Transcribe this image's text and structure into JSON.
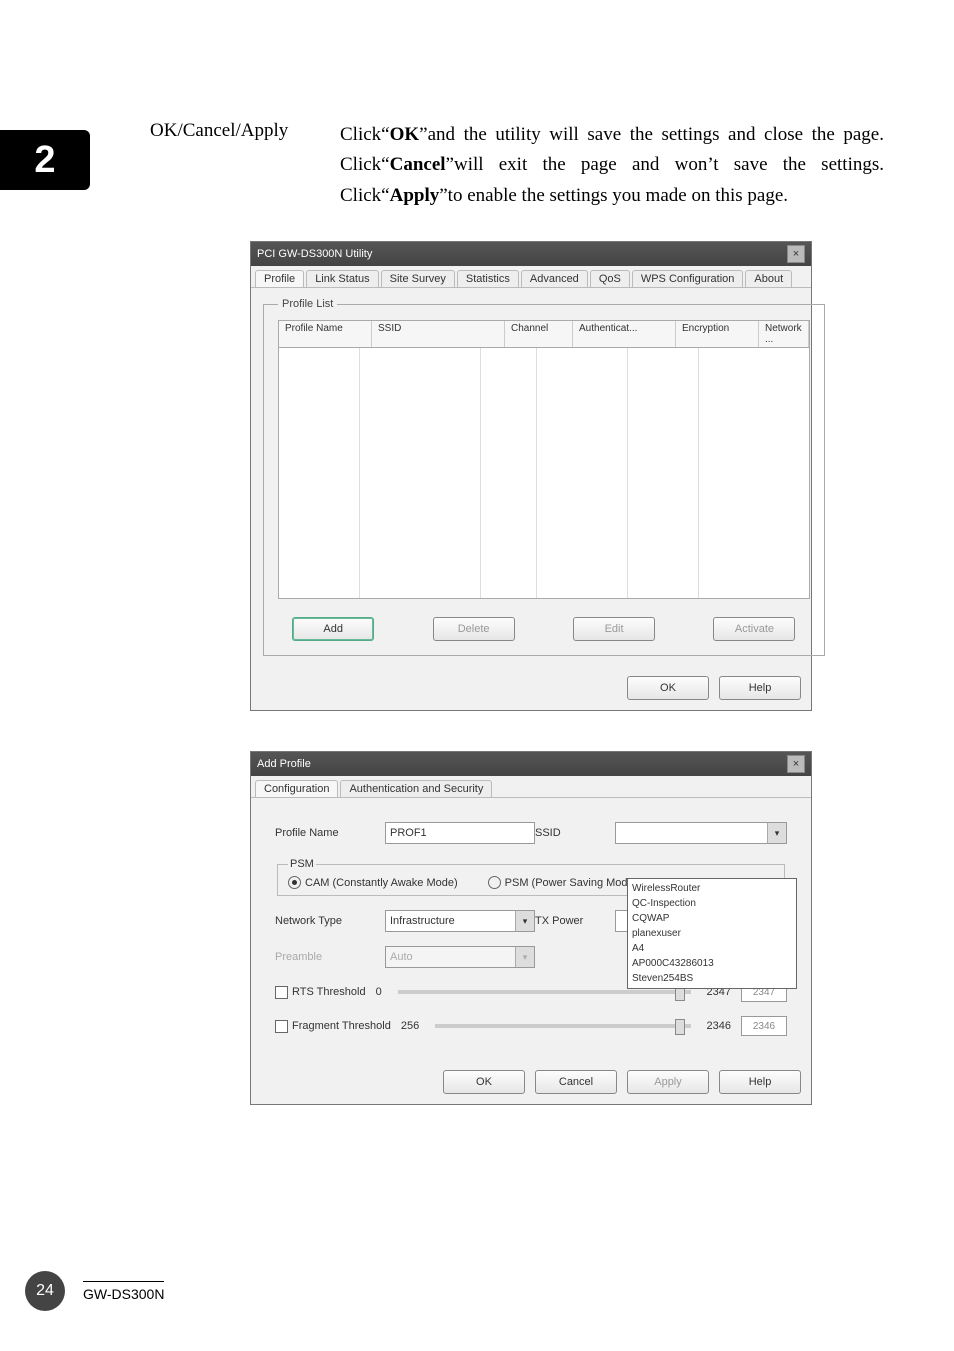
{
  "chapter_number": "2",
  "row": {
    "label": "OK/Cancel/Apply",
    "desc_parts": {
      "p1": "Click“",
      "b1": "OK",
      "p2": "”and the utility will save the settings and close the page. Click“",
      "b2": "Cancel",
      "p3": "”will exit the page and won’t save the settings. Click“",
      "b3": "Apply",
      "p4": "”to enable the settings you made on this page."
    }
  },
  "shot1": {
    "title": "PCI GW-DS300N Utility",
    "tabs": [
      "Profile",
      "Link Status",
      "Site Survey",
      "Statistics",
      "Advanced",
      "QoS",
      "WPS Configuration",
      "About"
    ],
    "active_tab_index": 0,
    "group_label": "Profile List",
    "columns": [
      "Profile Name",
      "SSID",
      "Channel",
      "Authenticat...",
      "Encryption",
      "Network ..."
    ],
    "buttons": {
      "add": "Add",
      "delete": "Delete",
      "edit": "Edit",
      "activate": "Activate"
    },
    "bottom": {
      "ok": "OK",
      "help": "Help"
    }
  },
  "shot2": {
    "title": "Add Profile",
    "tabs": [
      "Configuration",
      "Authentication and Security"
    ],
    "active_tab_index": 0,
    "labels": {
      "profile_name": "Profile Name",
      "ssid": "SSID",
      "psm": "PSM",
      "cam": "CAM (Constantly Awake Mode)",
      "psm_radio": "PSM (Power Saving Mode)",
      "network_type": "Network Type",
      "tx_power": "TX Power",
      "preamble": "Preamble",
      "rts": "RTS Threshold",
      "frag": "Fragment Threshold"
    },
    "values": {
      "profile_name": "PROF1",
      "ssid": "",
      "network_type": "Infrastructure",
      "tx_power": "",
      "preamble": "Auto",
      "rts_min": "0",
      "rts_val": "2347",
      "rts_box": "2347",
      "frag_min": "256",
      "frag_val": "2346",
      "frag_box": "2346"
    },
    "ssid_list": [
      "WirelessRouter",
      "QC-Inspection",
      "CQWAP",
      "planexuser",
      "A4",
      "AP000C43286013",
      "Steven254BS"
    ],
    "bottom": {
      "ok": "OK",
      "cancel": "Cancel",
      "apply": "Apply",
      "help": "Help"
    }
  },
  "footer": {
    "page": "24",
    "model": "GW-DS300N"
  }
}
